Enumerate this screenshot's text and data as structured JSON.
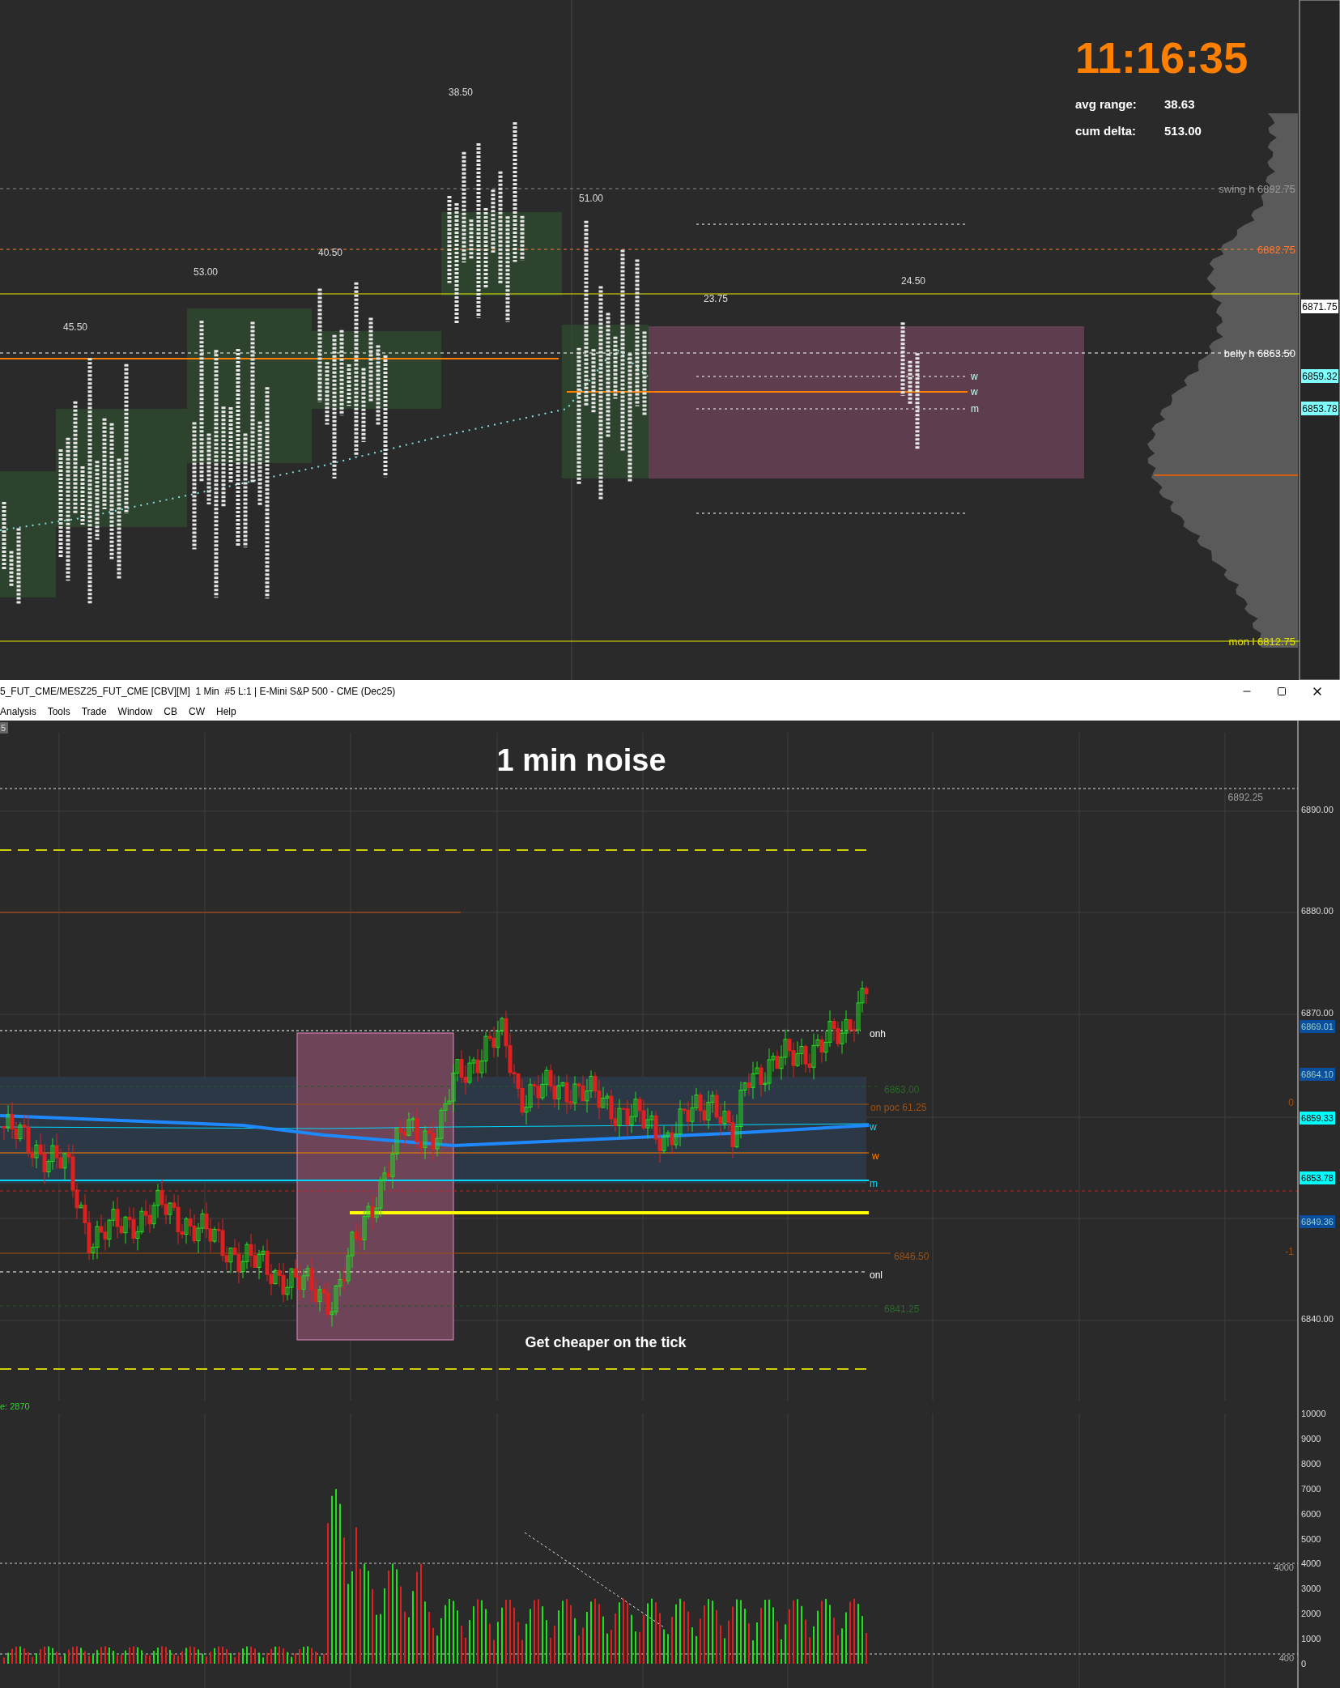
{
  "top_chart": {
    "clock": "11:16:35",
    "stats": [
      {
        "label": "avg range:",
        "value": "38.63"
      },
      {
        "label": "cum delta:",
        "value": "513.00"
      }
    ],
    "period_labels": [
      "45.50",
      "53.00",
      "40.50",
      "38.50",
      "51.00",
      "23.75",
      "24.50"
    ],
    "level_labels": [
      {
        "name": "swing h",
        "price": "6892.75"
      },
      {
        "price": "6882.75"
      },
      {
        "name": "belly h",
        "price": "6863.50"
      },
      {
        "name": "mon l",
        "price": "6812.75"
      }
    ],
    "line_markers": [
      "w",
      "w",
      "m"
    ],
    "price_tags": [
      {
        "text": "6871.75",
        "color": "#ffffff"
      },
      {
        "text": "6859.32",
        "color": "#80ffff"
      },
      {
        "text": "6853.78",
        "color": "#80ffff"
      }
    ]
  },
  "window": {
    "title": "5_FUT_CME/MESZ25_FUT_CME [CBV][M]  1 Min  #5 L:1 | E-Mini S&P 500 - CME (Dec25)",
    "menu": [
      "Analysis",
      "Tools",
      "Trade",
      "Window",
      "CB",
      "CW",
      "Help"
    ],
    "tab": "5"
  },
  "price_chart": {
    "title": "1 min noise",
    "annotation": "Get cheaper on the tick",
    "axis_labels": [
      "6890.00",
      "6880.00",
      "6870.00",
      "6840.00"
    ],
    "price_tags": [
      {
        "text": "6869.01",
        "color": "#0a4f9e"
      },
      {
        "text": "6864.10",
        "color": "#0a4f9e"
      },
      {
        "text": "6859.33",
        "color": "#00ffff"
      },
      {
        "text": "6853.78",
        "color": "#00ffff"
      },
      {
        "text": "6849.36",
        "color": "#0a4f9e"
      }
    ],
    "line_labels": [
      "6892.25",
      "onh",
      "6863.00",
      "on poc 61.25",
      "w",
      "w",
      "m",
      "6846.50",
      "onl",
      "6841.25"
    ],
    "side_labels": [
      "0",
      "-1"
    ]
  },
  "volume_chart": {
    "reading": "e: 2870",
    "axis_labels": [
      "10000",
      "9000",
      "8000",
      "7000",
      "6000",
      "5000",
      "4000",
      "3000",
      "2000",
      "1000",
      "0"
    ],
    "line_labels": [
      "4000",
      "400"
    ]
  }
}
